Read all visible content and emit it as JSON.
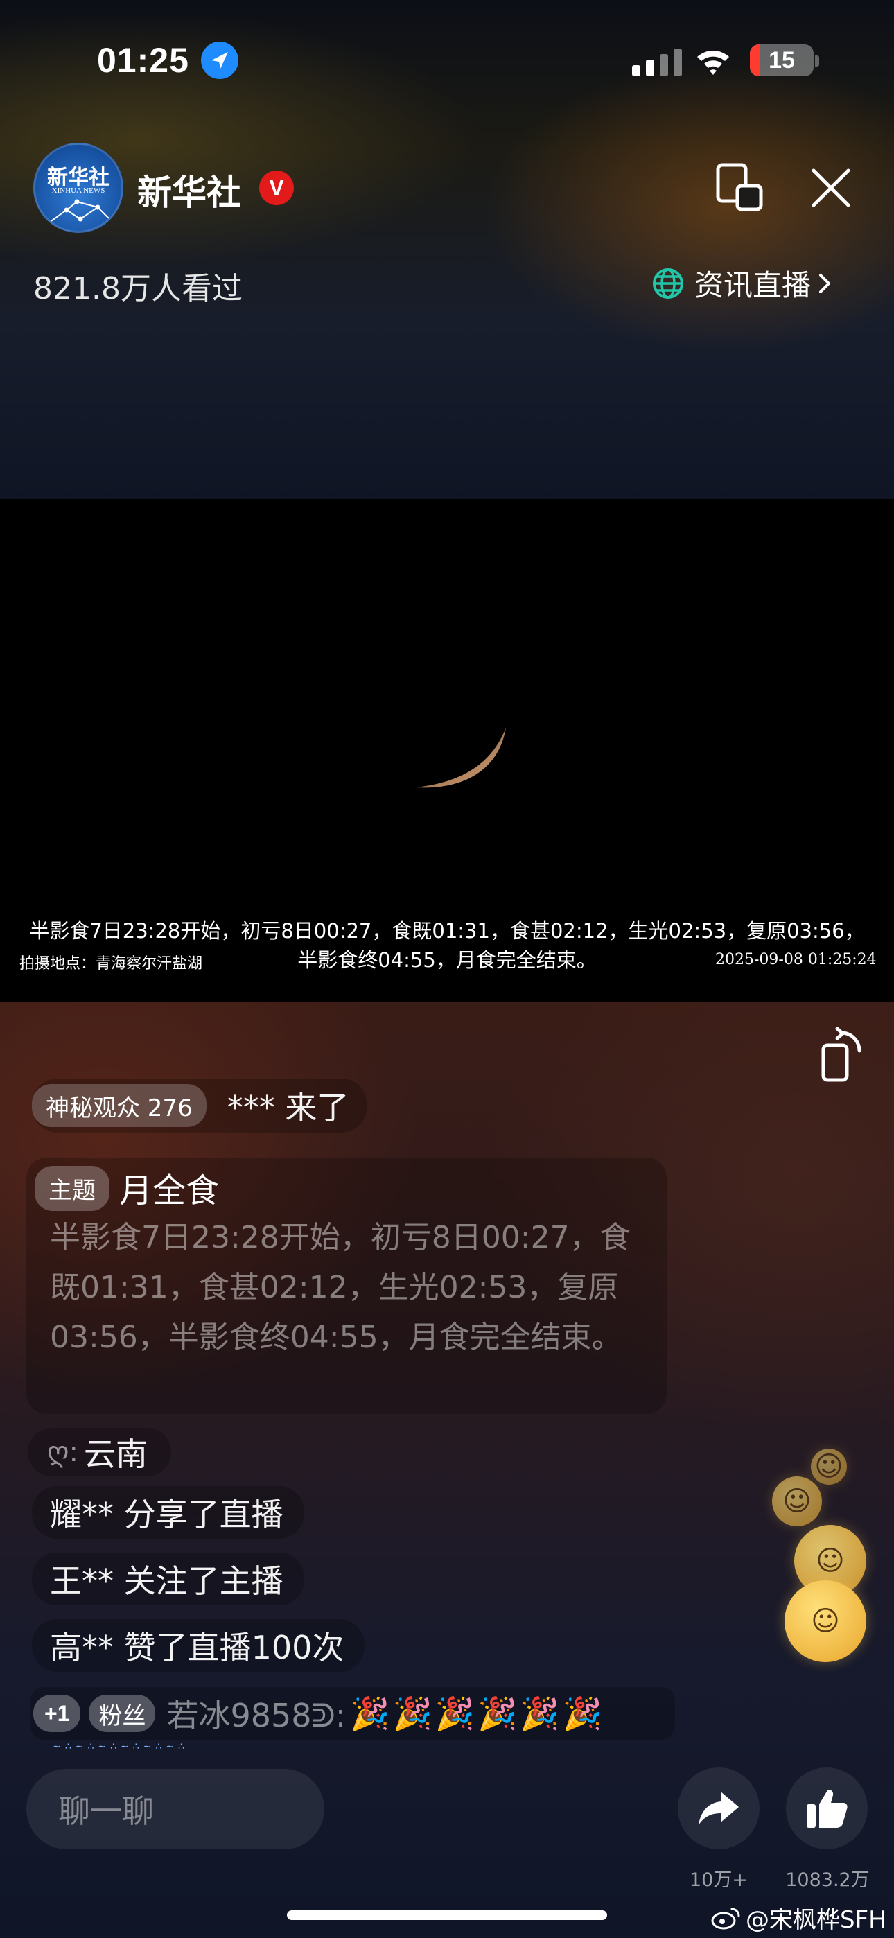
{
  "status_bar": {
    "time": "01:25",
    "battery": "15",
    "battery_level": 0.15
  },
  "header": {
    "channel_name": "新华社",
    "verified_badge": "V",
    "logo_text_cn": "新华社",
    "logo_text_en": "XINHUA NEWS",
    "views": "821.8万人看过",
    "category": "资讯直播"
  },
  "video": {
    "caption_line1": "半影食7日23:28开始，初亏8日00:27，食既01:31，食甚02:12，生光02:53，复原03:56，",
    "caption_line2": "半影食终04:55，月食完全结束。",
    "location": "拍摄地点：青海察尔汗盐湖",
    "timestamp": "2025-09-08 01:25:24"
  },
  "chat": {
    "join_tag": "神秘观众 276",
    "join_text": "*** 来了",
    "topic_tag": "主题",
    "topic_title": "月全食",
    "topic_body": "半影食7日23:28开始，初亏8日00:27，食既01:31，食甚02:12，生光02:53，复原03:56，半影食终04:55，月食完全结束。",
    "region_mark": "ღ:",
    "region": "云南",
    "share_event": "耀** 分享了直播",
    "follow_event": "王** 关注了主播",
    "like_event": "高** 赞了直播100次",
    "msg_level": "+1",
    "msg_fan_tag": "粉丝",
    "msg_user": "若冰9858ᕲ:",
    "msg_text": "🎉🎉🎉🎉🎉🎉"
  },
  "bottom_bar": {
    "chat_placeholder": "聊一聊",
    "share_count": "10万+",
    "like_count": "1083.2万"
  },
  "watermark": "@宋枫桦SFH",
  "colors": {
    "accent_blue": "#1e8bff",
    "verified_red": "#e21a1a",
    "battery_red": "#ff3b30",
    "globe_teal": "#21c7a8"
  }
}
